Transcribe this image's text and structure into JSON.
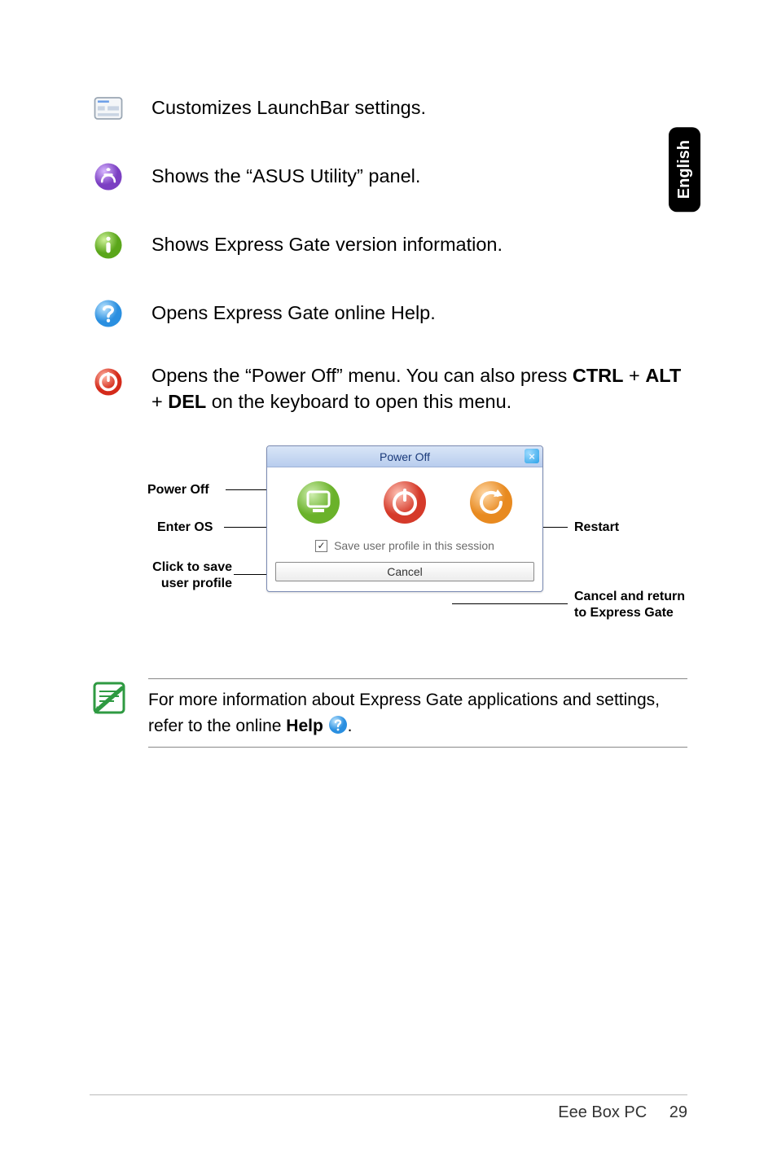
{
  "language_tab": "English",
  "rows": [
    {
      "text": "Customizes LaunchBar settings.",
      "icon": "launchbar-settings-icon"
    },
    {
      "text": "Shows the “ASUS Utility” panel.",
      "icon": "asus-utility-icon"
    },
    {
      "text": "Shows Express Gate version information.",
      "icon": "info-icon"
    },
    {
      "text": "Opens Express Gate online Help.",
      "icon": "help-icon"
    },
    {
      "text_pre": "Opens the “Power Off” menu. You can also press ",
      "key1": "CTRL",
      "plus1": " + ",
      "key2": "ALT",
      "plus2": " + ",
      "key3": "DEL",
      "text_post": " on the keyboard to open this menu.",
      "icon": "power-icon"
    }
  ],
  "dialog": {
    "title": "Power Off",
    "save_label": "Save user profile in this session",
    "cancel_label": "Cancel",
    "checked": true
  },
  "callouts": {
    "power_off": "Power Off",
    "enter_os": "Enter OS",
    "click_save_l1": "Click to save",
    "click_save_l2": "user profile",
    "restart": "Restart",
    "cancel_l1": "Cancel and return",
    "cancel_l2": "to Express Gate"
  },
  "note": {
    "pre": "For more information about Express Gate applications and settings, refer to the online ",
    "help_word": "Help",
    "post": "."
  },
  "footer": {
    "title": "Eee Box PC",
    "page": "29"
  }
}
